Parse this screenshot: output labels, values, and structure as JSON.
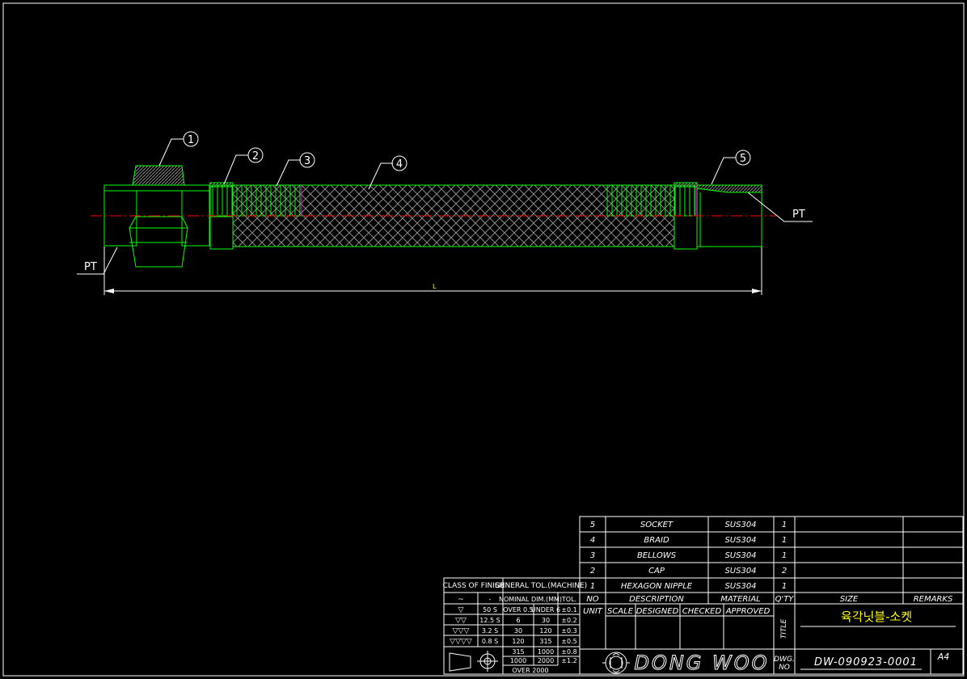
{
  "drawing": {
    "balloons": [
      "1",
      "2",
      "3",
      "4",
      "5"
    ],
    "thread_left": "PT",
    "thread_right": "PT",
    "length_label": "L"
  },
  "parts_list": {
    "rows": [
      {
        "no": "5",
        "description": "SOCKET",
        "material": "SUS304",
        "qty": "1"
      },
      {
        "no": "4",
        "description": "BRAID",
        "material": "SUS304",
        "qty": "1"
      },
      {
        "no": "3",
        "description": "BELLOWS",
        "material": "SUS304",
        "qty": "1"
      },
      {
        "no": "2",
        "description": "CAP",
        "material": "SUS304",
        "qty": "2"
      },
      {
        "no": "1",
        "description": "HEXAGON NIPPLE",
        "material": "SUS304",
        "qty": "1"
      }
    ],
    "header": {
      "no": "NO",
      "description": "DESCRIPTION",
      "material": "MATERIAL",
      "qty": "Q'TY",
      "size": "SIZE",
      "remarks": "REMARKS"
    }
  },
  "finish_table": {
    "title": "CLASS OF FINISH",
    "rows": [
      {
        "symbol": "~",
        "value": "-"
      },
      {
        "symbol": "▽",
        "value": "50 S"
      },
      {
        "symbol": "▽▽",
        "value": "12.5 S"
      },
      {
        "symbol": "▽▽▽",
        "value": "3.2 S"
      },
      {
        "symbol": "▽▽▽▽",
        "value": "0.8 S"
      }
    ]
  },
  "tolerance_table": {
    "title": "GENERAL TOL.(MACHINE)",
    "header_dim": "NOMINAL DIM.(MM)",
    "header_tol": "TOL.",
    "rows": [
      {
        "a": "OVER 0.5",
        "b": "UNDER 6",
        "tol": "±0.1"
      },
      {
        "a": "6",
        "b": "30",
        "tol": "±0.2"
      },
      {
        "a": "30",
        "b": "120",
        "tol": "±0.3"
      },
      {
        "a": "120",
        "b": "315",
        "tol": "±0.5"
      },
      {
        "a": "315",
        "b": "1000",
        "tol": "±0.8"
      },
      {
        "a": "1000",
        "b": "2000",
        "tol": "±1.2"
      }
    ],
    "footer": "OVER 2000"
  },
  "title_block": {
    "unit": "UNIT",
    "scale": "SCALE",
    "designed": "DESIGNED",
    "checked": "CHECKED",
    "approved": "APPROVED",
    "title_label": "TITLE",
    "title_value": "육각닛블-소켓",
    "company": "DONG WOO",
    "dwg_label_1": "DWG.",
    "dwg_label_2": "NO",
    "dwg_no": "DW-090923-0001",
    "sheet": "A4"
  },
  "colors": {
    "background": "#000000",
    "line": "#ffffff",
    "part": "#00ff00",
    "centerline": "#ff0000",
    "hatch": "#8a8a8a",
    "title": "#ffff00",
    "bellows_edge": "#ff00ff"
  }
}
